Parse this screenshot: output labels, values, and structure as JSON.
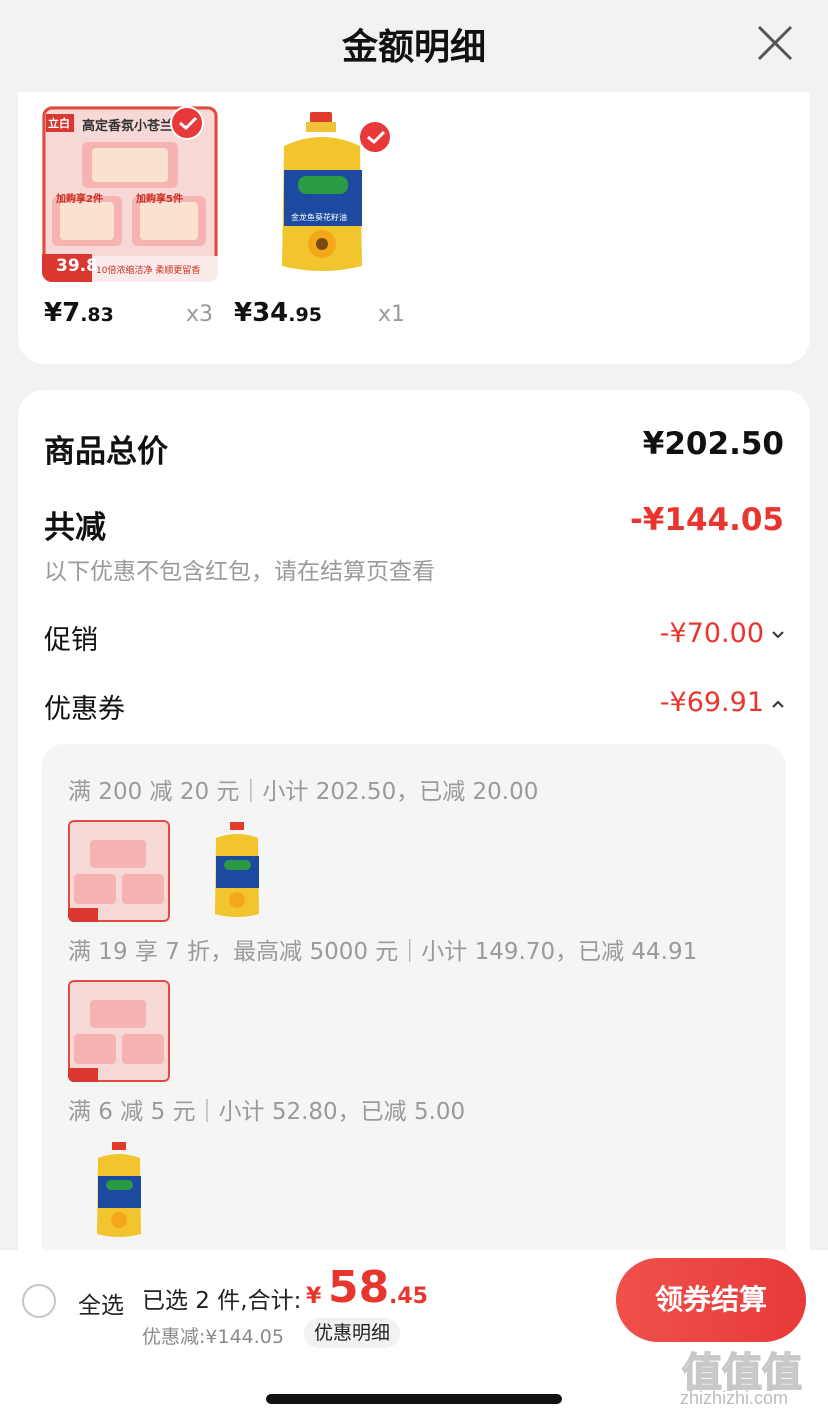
{
  "header": {
    "title": "金额明细"
  },
  "products": [
    {
      "image_text": "高定香氛小苍兰",
      "brand": "立白",
      "badge_price": "39.8",
      "promo_left": "加购享2件",
      "promo_right": "加购享5件",
      "tagline": "10倍浓缩洁净 柔顺更留香",
      "price_int": "¥7",
      "price_dec": ".83",
      "qty": "x3",
      "checked": true
    },
    {
      "image_text": "金龙鱼葵花籽油",
      "price_int": "¥34",
      "price_dec": ".95",
      "qty": "x1",
      "checked": true
    }
  ],
  "summary": {
    "total_label": "商品总价",
    "total_value": "¥202.50",
    "reduce_label": "共减",
    "reduce_value": "-¥144.05",
    "note": "以下优惠不包含红包，请在结算页查看",
    "promo_label": "促销",
    "promo_value": "-¥70.00",
    "coupon_label": "优惠券",
    "coupon_value": "-¥69.91"
  },
  "coupon_rules": [
    {
      "text": "满 200 减 20 元｜小计 202.50，已减 20.00"
    },
    {
      "text": "满 19 享 7 折，最高减 5000 元｜小计 149.70，已减 44.91"
    },
    {
      "text": "满 6 减 5 元｜小计 52.80，已减 5.00"
    }
  ],
  "bottom_bar": {
    "select_all": "全选",
    "selected": "已选 2 件,合计:",
    "currency": "¥",
    "total_int": "58",
    "total_dec": ".45",
    "discount": "优惠减:¥144.05",
    "detail_link": "优惠明细",
    "checkout": "领券结算"
  },
  "watermark": {
    "logo": "值值值",
    "url": "zhizhizhi.com"
  },
  "colors": {
    "accent": "#e8362f",
    "background": "#f2f2f2"
  }
}
